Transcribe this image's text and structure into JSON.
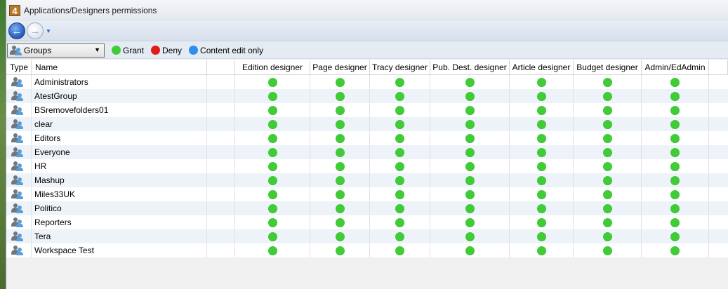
{
  "window": {
    "title": "Applications/Designers permissions",
    "app_icon_text": "4"
  },
  "nav": {
    "back_icon": "arrow-left-icon",
    "forward_icon": "arrow-right-icon"
  },
  "toolbar": {
    "combo_value": "Groups",
    "legend": [
      {
        "label": "Grant",
        "color": "#3fcc37"
      },
      {
        "label": "Deny",
        "color": "#e31b1b"
      },
      {
        "label": "Content edit only",
        "color": "#2d8ff0"
      }
    ]
  },
  "table": {
    "columns": [
      "Type",
      "Name",
      "",
      "Edition designer",
      "Page designer",
      "Tracy designer",
      "Pub. Dest. designer",
      "Article designer",
      "Budget designer",
      "Admin/EdAdmin"
    ],
    "rows": [
      {
        "name": "Administrators",
        "perms": [
          "grant",
          "grant",
          "grant",
          "grant",
          "grant",
          "grant",
          "grant"
        ]
      },
      {
        "name": "AtestGroup",
        "perms": [
          "grant",
          "grant",
          "grant",
          "grant",
          "grant",
          "grant",
          "grant"
        ]
      },
      {
        "name": "BSremovefolders01",
        "perms": [
          "grant",
          "grant",
          "grant",
          "grant",
          "grant",
          "grant",
          "grant"
        ]
      },
      {
        "name": "clear",
        "perms": [
          "grant",
          "grant",
          "grant",
          "grant",
          "grant",
          "grant",
          "grant"
        ]
      },
      {
        "name": "Editors",
        "perms": [
          "grant",
          "grant",
          "grant",
          "grant",
          "grant",
          "grant",
          "grant"
        ]
      },
      {
        "name": "Everyone",
        "perms": [
          "grant",
          "grant",
          "grant",
          "grant",
          "grant",
          "grant",
          "grant"
        ]
      },
      {
        "name": "HR",
        "perms": [
          "grant",
          "grant",
          "grant",
          "grant",
          "grant",
          "grant",
          "grant"
        ]
      },
      {
        "name": "Mashup",
        "perms": [
          "grant",
          "grant",
          "grant",
          "grant",
          "grant",
          "grant",
          "grant"
        ]
      },
      {
        "name": "Miles33UK",
        "perms": [
          "grant",
          "grant",
          "grant",
          "grant",
          "grant",
          "grant",
          "grant"
        ]
      },
      {
        "name": "Politico",
        "perms": [
          "grant",
          "grant",
          "grant",
          "grant",
          "grant",
          "grant",
          "grant"
        ]
      },
      {
        "name": "Reporters",
        "perms": [
          "grant",
          "grant",
          "grant",
          "grant",
          "grant",
          "grant",
          "grant"
        ]
      },
      {
        "name": "Tera",
        "perms": [
          "grant",
          "grant",
          "grant",
          "grant",
          "grant",
          "grant",
          "grant"
        ]
      },
      {
        "name": "Workspace Test",
        "perms": [
          "grant",
          "grant",
          "grant",
          "grant",
          "grant",
          "grant",
          "grant"
        ]
      }
    ]
  }
}
